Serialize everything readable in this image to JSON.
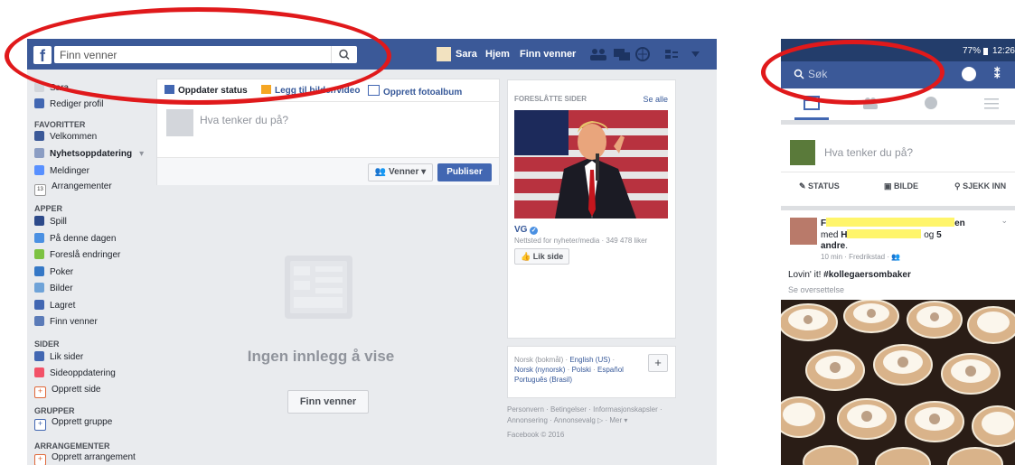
{
  "desktop": {
    "header": {
      "search_placeholder": "Finn venner",
      "user_name": "Sara",
      "nav_home": "Hjem",
      "nav_find_friends": "Finn venner"
    },
    "sidebar": {
      "user_name": "Sara",
      "edit_profile": "Rediger profil",
      "favorites_heading": "FAVORITTER",
      "favorites": [
        "Velkommen",
        "Nyhetsoppdatering",
        "Meldinger",
        "Arrangementer"
      ],
      "calendar_day": "13",
      "apps_heading": "APPER",
      "apps": [
        "Spill",
        "På denne dagen",
        "Foreslå endringer",
        "Poker",
        "Bilder",
        "Lagret",
        "Finn venner"
      ],
      "pages_heading": "SIDER",
      "pages": [
        "Lik sider",
        "Sideoppdatering",
        "Opprett side"
      ],
      "groups_heading": "GRUPPER",
      "groups": [
        "Opprett gruppe"
      ],
      "events_heading": "ARRANGEMENTER",
      "events": [
        "Opprett arrangement"
      ]
    },
    "composer": {
      "tab_status": "Oppdater status",
      "tab_photo": "Legg til bilder/video",
      "tab_album": "Opprett fotoalbum",
      "placeholder": "Hva tenker du på?",
      "audience": "Venner",
      "publish": "Publiser"
    },
    "feed": {
      "empty_title": "Ingen innlegg å vise",
      "find_friends_button": "Finn venner"
    },
    "suggested": {
      "heading": "FORESLÅTTE SIDER",
      "see_all": "Se alle",
      "page_name": "VG",
      "page_meta": "Nettsted for nyheter/media · 349 478 liker",
      "like_button": "Lik side"
    },
    "languages": {
      "items": [
        "Norsk (bokmål)",
        "English (US)",
        "Norsk (nynorsk)",
        "Polski",
        "Español",
        "Português (Brasil)"
      ]
    },
    "footer": {
      "line1": "Personvern · Betingelser · Informasjonskapsler ·",
      "line2": "Annonsering · Annonsevalg",
      "more": "· Mer ▾",
      "copyright": "Facebook © 2016"
    }
  },
  "mobile": {
    "status": {
      "battery": "77%",
      "time": "12:26"
    },
    "search_placeholder": "Søk",
    "composer_placeholder": "Hva tenker du på?",
    "actions": [
      "STATUS",
      "BILDE",
      "SJEKK INN"
    ],
    "post": {
      "author_initial": "F",
      "author_end": "en",
      "with_label": "med",
      "with_initial": "H",
      "and_text": "og",
      "others_count": "5",
      "others_label": "andre",
      "meta": "10 min · Fredrikstad ·",
      "text_prefix": "Lovin' it!",
      "hashtag": "#kollegaersombaker",
      "translate": "Se oversettelse"
    }
  },
  "colors": {
    "brand": "#3b5998",
    "annotation": "#e0191b",
    "highlight": "#fff56b"
  }
}
